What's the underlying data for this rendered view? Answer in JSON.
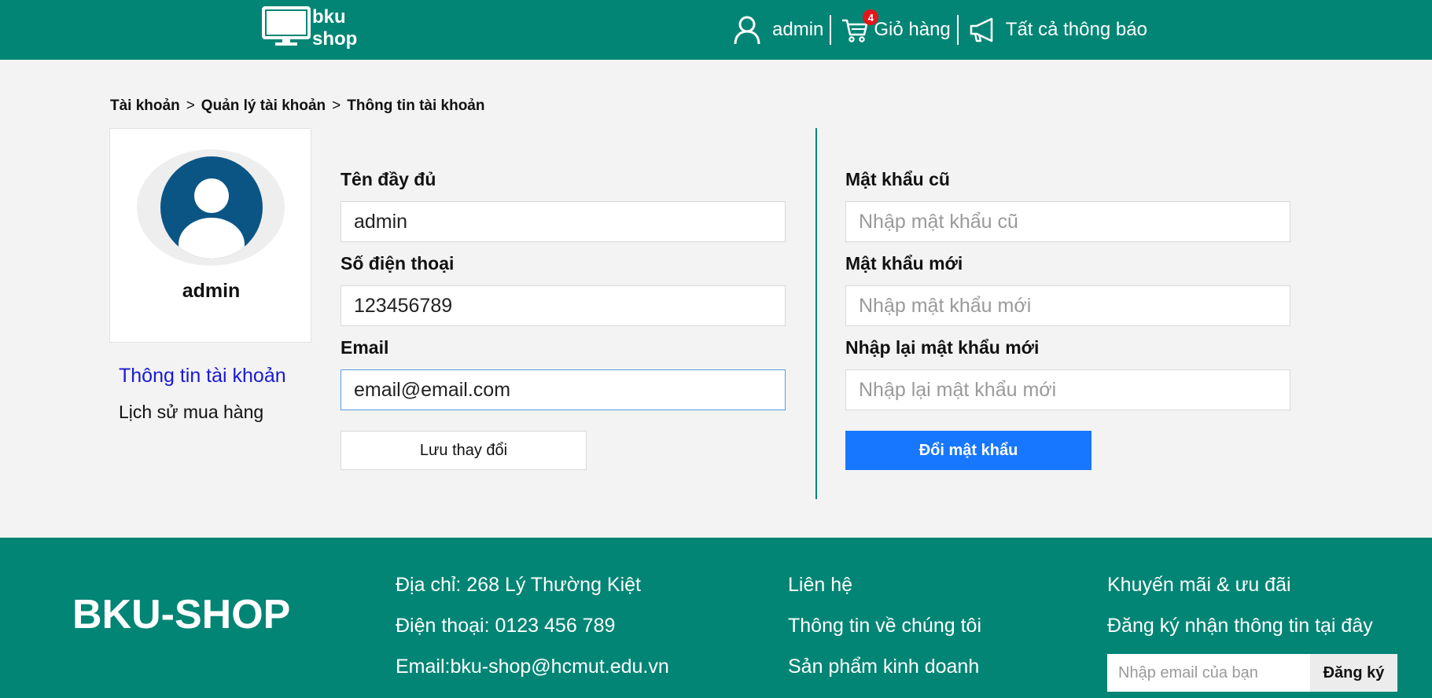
{
  "header": {
    "logo_line1": "bku",
    "logo_line2": "shop",
    "user_label": "admin",
    "cart_label": "Giỏ hàng",
    "cart_count": "4",
    "notifications_label": "Tất cả thông báo",
    "icons": [
      "monitor-logo-icon",
      "user-icon",
      "cart-icon",
      "megaphone-icon"
    ]
  },
  "breadcrumb": [
    "Tài khoản",
    "Quản lý tài khoản",
    "Thông tin tài khoản"
  ],
  "profile": {
    "name": "admin"
  },
  "sidebar": {
    "items": [
      {
        "label": "Thông tin tài khoản",
        "active": true
      },
      {
        "label": "Lịch sử mua hàng",
        "active": false
      }
    ]
  },
  "info_form": {
    "fullname_label": "Tên đầy đủ",
    "fullname_value": "admin",
    "phone_label": "Số điện thoại",
    "phone_value": "123456789",
    "email_label": "Email",
    "email_value": "email@email.com",
    "save_button": "Lưu thay đổi"
  },
  "password_form": {
    "old_label": "Mật khẩu cũ",
    "old_placeholder": "Nhập mật khẩu cũ",
    "new_label": "Mật khẩu mới",
    "new_placeholder": "Nhập mật khẩu mới",
    "confirm_label": "Nhập lại mật khẩu mới",
    "confirm_placeholder": "Nhập lại mật khẩu mới",
    "submit_button": "Đổi mật khẩu"
  },
  "footer": {
    "brand": "BKU-SHOP",
    "contact": [
      "Địa chỉ: 268 Lý Thường Kiệt",
      "Điện thoại: 0123 456 789",
      "Email:bku-shop@hcmut.edu.vn"
    ],
    "links": [
      "Liên hệ",
      "Thông tin về chúng tôi",
      "Sản phẩm kinh doanh"
    ],
    "promo_title": "Khuyến mãi & ưu đãi",
    "subscribe_text": "Đăng ký nhận thông tin tại đây",
    "subscribe_placeholder": "Nhập email của bạn",
    "subscribe_button": "Đăng ký"
  },
  "colors": {
    "primary": "#028575",
    "accent_blue": "#1877ff",
    "active_link": "#1919d6",
    "badge": "#e3161c",
    "avatar": "#0b5585"
  }
}
